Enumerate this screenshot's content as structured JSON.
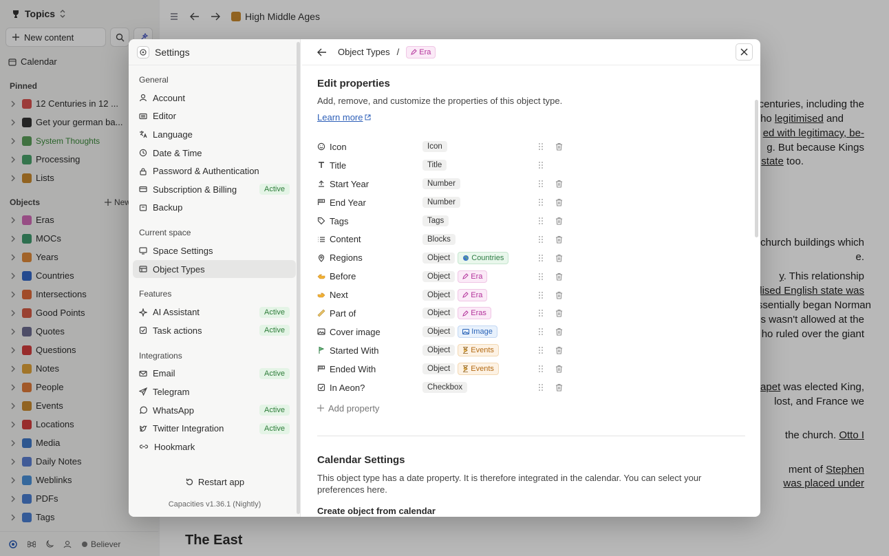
{
  "sidebar": {
    "space_title": "Topics",
    "new_content": "New content",
    "calendar": "Calendar",
    "pinned_label": "Pinned",
    "pinned": [
      {
        "label": "12 Centuries in 12 ...",
        "color": "#d9534f"
      },
      {
        "label": "Get your german ba...",
        "color": "#333333"
      },
      {
        "label": "System Thoughts",
        "color": "#5a9e5a"
      },
      {
        "label": "Processing",
        "color": "#4aa36b"
      },
      {
        "label": "Lists",
        "color": "#c98a2e"
      }
    ],
    "objects_label": "Objects",
    "new_type": "New type",
    "objects": [
      {
        "label": "Eras",
        "color": "#d16bb8"
      },
      {
        "label": "MOCs",
        "color": "#3f9a6e"
      },
      {
        "label": "Years",
        "color": "#e08a3a"
      },
      {
        "label": "Countries",
        "color": "#3367c7"
      },
      {
        "label": "Intersections",
        "color": "#e06a3a"
      },
      {
        "label": "Good Points",
        "color": "#d45b44"
      },
      {
        "label": "Quotes",
        "color": "#6b6b8f"
      },
      {
        "label": "Questions",
        "color": "#d33d3d"
      },
      {
        "label": "Notes",
        "color": "#e0a33a"
      },
      {
        "label": "People",
        "color": "#e07a3a"
      },
      {
        "label": "Events",
        "color": "#c98a2e"
      },
      {
        "label": "Locations",
        "color": "#d33d3d"
      },
      {
        "label": "Media",
        "color": "#3f78c7"
      },
      {
        "label": "Daily Notes",
        "color": "#5a7fd1"
      },
      {
        "label": "Weblinks",
        "color": "#4a90d9"
      },
      {
        "label": "PDFs",
        "color": "#4a7fd1"
      },
      {
        "label": "Tags",
        "color": "#4a7fd1"
      }
    ],
    "footer_user": "Believer"
  },
  "page": {
    "title": "High Middle Ages",
    "heading_east": "The East",
    "lines": [
      {
        "text": "centuries, including the",
        "u": false
      },
      {
        "text": "who ",
        "u": false,
        "link": "legitimised",
        "rest": " and"
      },
      {
        "text": "",
        "link": "ed with legitimacy, be-",
        "rest": ""
      },
      {
        "text": "",
        "link": "g",
        "rest": ". But because Kings"
      },
      {
        "text": "",
        "link": "state",
        "rest": " too."
      },
      {
        "text": "of church buildings which",
        "u": false
      },
      {
        "text": "e.",
        "u": false
      },
      {
        "text": "",
        "link": "y",
        "rest": ". This relationship"
      },
      {
        "text": "",
        "link": "lised English state was",
        "rest": ""
      },
      {
        "text": "essentially began Norman",
        "u": false
      },
      {
        "text": "s wasn't allowed at the",
        "u": false
      },
      {
        "text": "ho ruled over the giant",
        "u": false
      },
      {
        "text": "",
        "link": "apet",
        "rest": " was elected King,"
      },
      {
        "text": " lost, and France we",
        "u": false
      },
      {
        "text": "the church. ",
        "link": "Otto I",
        "rest": ""
      },
      {
        "text": "ment of ",
        "link": "Stephen",
        "rest": ""
      },
      {
        "text": "",
        "link": " was placed under",
        "rest": ""
      }
    ]
  },
  "settings": {
    "title": "Settings",
    "sections": [
      {
        "label": "General",
        "items": [
          {
            "label": "Account",
            "icon": "user-icon"
          },
          {
            "label": "Editor",
            "icon": "keyboard-icon"
          },
          {
            "label": "Language",
            "icon": "language-icon"
          },
          {
            "label": "Date & Time",
            "icon": "clock-icon"
          },
          {
            "label": "Password & Authentication",
            "icon": "lock-icon"
          },
          {
            "label": "Subscription & Billing",
            "icon": "card-icon",
            "badge": "Active"
          },
          {
            "label": "Backup",
            "icon": "backup-icon"
          }
        ]
      },
      {
        "label": "Current space",
        "items": [
          {
            "label": "Space Settings",
            "icon": "monitor-icon"
          },
          {
            "label": "Object Types",
            "icon": "table-icon",
            "selected": true
          }
        ]
      },
      {
        "label": "Features",
        "items": [
          {
            "label": "AI Assistant",
            "icon": "sparkle-icon",
            "badge": "Active"
          },
          {
            "label": "Task actions",
            "icon": "checkbox-icon",
            "badge": "Active"
          }
        ]
      },
      {
        "label": "Integrations",
        "items": [
          {
            "label": "Email",
            "icon": "mail-icon",
            "badge": "Active"
          },
          {
            "label": "Telegram",
            "icon": "send-icon"
          },
          {
            "label": "WhatsApp",
            "icon": "whatsapp-icon",
            "badge": "Active"
          },
          {
            "label": "Twitter Integration",
            "icon": "twitter-icon",
            "badge": "Active"
          },
          {
            "label": "Hookmark",
            "icon": "link-icon"
          }
        ]
      }
    ],
    "restart": "Restart app",
    "version": "Capacities v1.36.1 (Nightly)"
  },
  "content": {
    "breadcrumb_parent": "Object Types",
    "breadcrumb_sep": "/",
    "breadcrumb_chip": "Era",
    "edit_title": "Edit properties",
    "edit_desc": "Add, remove, and customize the properties of this object type.",
    "learn_more": "Learn more",
    "properties": [
      {
        "name": "Icon",
        "icon": "smile-icon",
        "type": "Icon",
        "deletable": true
      },
      {
        "name": "Title",
        "icon": "text-icon",
        "type": "Title",
        "deletable": false
      },
      {
        "name": "Start Year",
        "icon": "upload-icon",
        "type": "Number",
        "deletable": true
      },
      {
        "name": "End Year",
        "icon": "finish-icon",
        "type": "Number",
        "deletable": true
      },
      {
        "name": "Tags",
        "icon": "tag-icon",
        "type": "Tags",
        "deletable": true
      },
      {
        "name": "Content",
        "icon": "list-icon",
        "type": "Blocks",
        "deletable": true
      },
      {
        "name": "Regions",
        "icon": "pin-icon",
        "type": "Object",
        "chip": "Countries",
        "chip_kind": "countries",
        "deletable": true
      },
      {
        "name": "Before",
        "icon": "hand-left-icon",
        "type": "Object",
        "chip": "Era",
        "chip_kind": "era",
        "deletable": true
      },
      {
        "name": "Next",
        "icon": "hand-right-icon",
        "type": "Object",
        "chip": "Era",
        "chip_kind": "era",
        "deletable": true
      },
      {
        "name": "Part of",
        "icon": "ruler-icon",
        "type": "Object",
        "chip": "Eras",
        "chip_kind": "era",
        "deletable": true
      },
      {
        "name": "Cover image",
        "icon": "image-icon",
        "type": "Object",
        "chip": "Image",
        "chip_kind": "image",
        "deletable": true
      },
      {
        "name": "Started With",
        "icon": "flag-start-icon",
        "type": "Object",
        "chip": "Events",
        "chip_kind": "events",
        "deletable": true
      },
      {
        "name": "Ended With",
        "icon": "finish-icon",
        "type": "Object",
        "chip": "Events",
        "chip_kind": "events",
        "deletable": true
      },
      {
        "name": "In Aeon?",
        "icon": "checkbox-icon",
        "type": "Checkbox",
        "deletable": true
      }
    ],
    "add_property": "Add property",
    "calendar_title": "Calendar Settings",
    "calendar_desc": "This object type has a date property. It is therefore integrated in the calendar. You can select your preferences here.",
    "calendar_sub": "Create object from calendar"
  },
  "colors": {
    "accent": "#2d5fb8",
    "active_bg": "#e4f4e6",
    "active_fg": "#2e7d3a"
  }
}
